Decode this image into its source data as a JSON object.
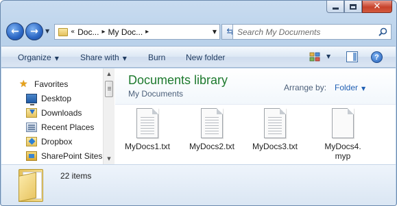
{
  "window": {
    "minimize_icon": "minimize-icon",
    "maximize_icon": "maximize-icon",
    "close_icon": "close-icon",
    "close_glyph": "✕"
  },
  "nav": {
    "back_glyph": "←",
    "forward_glyph": "→",
    "address": {
      "overflow_chevron": "«",
      "crumbs": [
        "Doc...",
        "My Doc..."
      ],
      "separator": "▸"
    },
    "search": {
      "placeholder": "Search My Documents"
    }
  },
  "toolbar": {
    "organize_label": "Organize",
    "share_label": "Share with",
    "burn_label": "Burn",
    "new_folder_label": "New folder",
    "help_label": "?"
  },
  "sidebar": {
    "favorites_label": "Favorites",
    "items": [
      {
        "label": "Desktop",
        "icon": "desktop-icon"
      },
      {
        "label": "Downloads",
        "icon": "downloads-icon"
      },
      {
        "label": "Recent Places",
        "icon": "recent-places-icon"
      },
      {
        "label": "Dropbox",
        "icon": "dropbox-icon"
      },
      {
        "label": "SharePoint Sites",
        "icon": "sharepoint-icon"
      }
    ]
  },
  "library": {
    "title": "Documents library",
    "subtitle": "My Documents",
    "arrange_label": "Arrange by:",
    "arrange_value": "Folder"
  },
  "files": [
    {
      "name": "MyDocs1.txt",
      "icon": "text-file-icon"
    },
    {
      "name": "MyDocs2.txt",
      "icon": "text-file-icon"
    },
    {
      "name": "MyDocs3.txt",
      "icon": "text-file-icon"
    },
    {
      "name": "MyDocs4.myp",
      "icon": "generic-file-icon"
    }
  ],
  "details": {
    "count_text": "22 items"
  }
}
